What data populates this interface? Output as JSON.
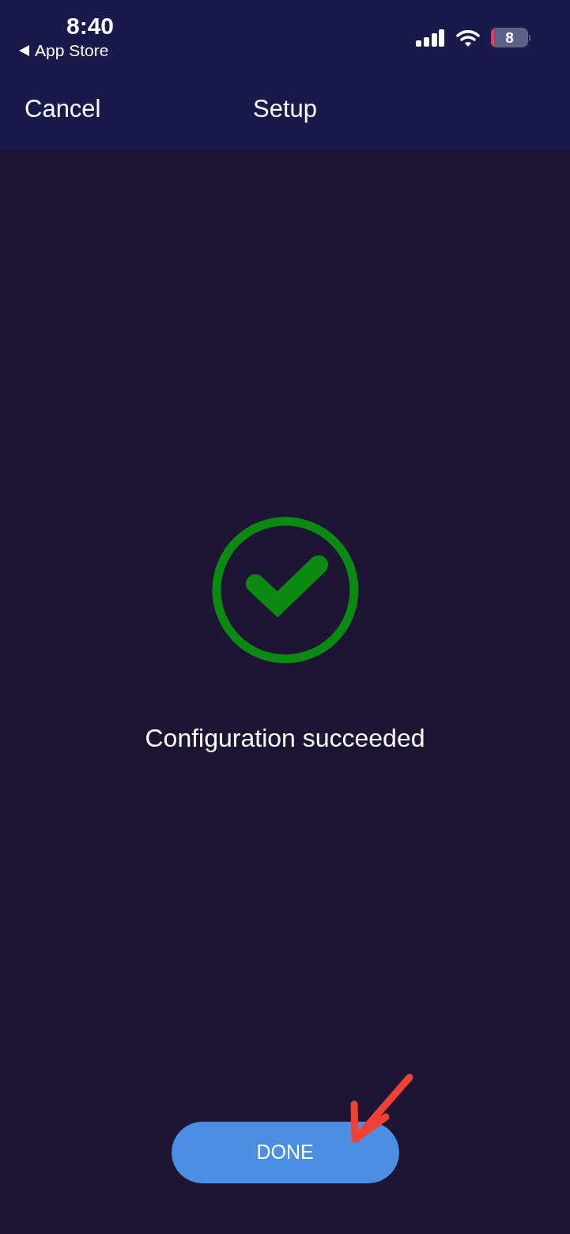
{
  "status_bar": {
    "time": "8:40",
    "back_link": "App Store",
    "battery": "8"
  },
  "nav_bar": {
    "cancel": "Cancel",
    "title": "Setup"
  },
  "result": {
    "kind": "success",
    "message": "Configuration succeeded"
  },
  "buttons": [
    {
      "label": "DONE"
    }
  ]
}
